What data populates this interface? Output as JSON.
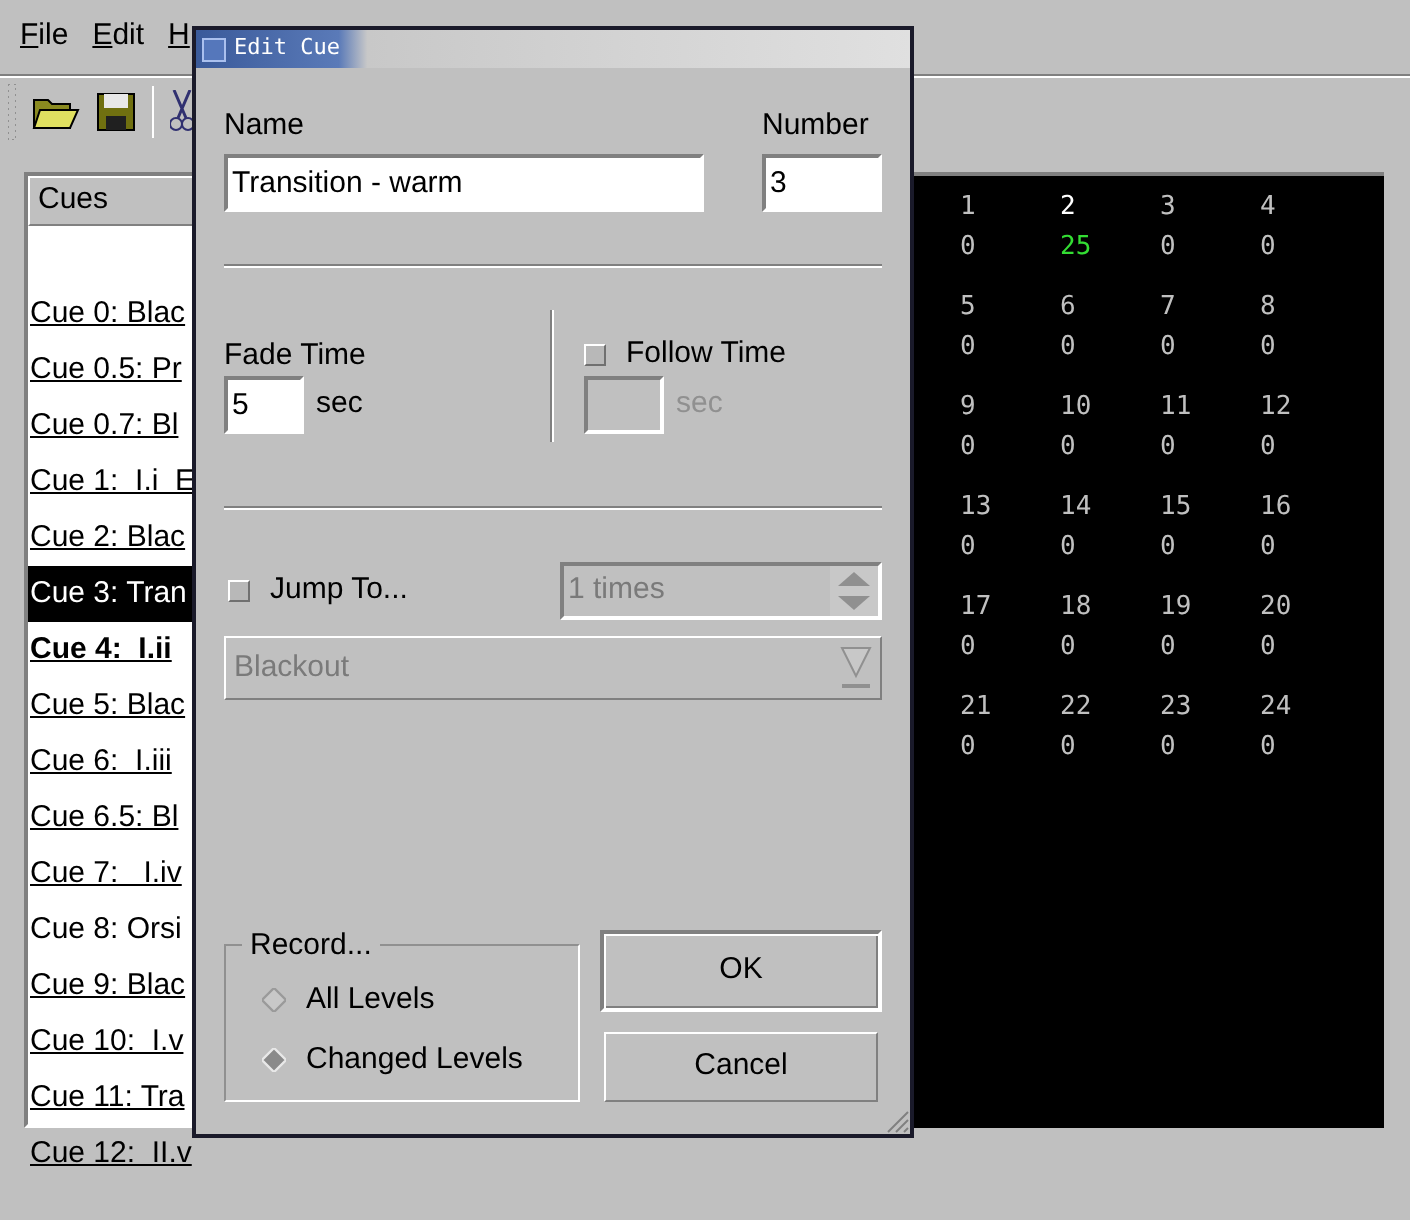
{
  "menu": [
    {
      "label": "File"
    },
    {
      "label": "Edit"
    },
    {
      "label": "H"
    }
  ],
  "cue_list": {
    "header": "Cues",
    "items": [
      {
        "label": "Cue 0: Blac",
        "selected": false,
        "current": false,
        "underlined": true
      },
      {
        "label": "Cue 0.5: Pr",
        "selected": false,
        "current": false,
        "underlined": true
      },
      {
        "label": "Cue 0.7: Bl",
        "selected": false,
        "current": false,
        "underlined": true
      },
      {
        "label": "Cue 1:  I.i  E",
        "selected": false,
        "current": false,
        "underlined": true
      },
      {
        "label": "Cue 2: Blac",
        "selected": false,
        "current": false,
        "underlined": true
      },
      {
        "label": "Cue 3: Tran",
        "selected": true,
        "current": false,
        "underlined": false
      },
      {
        "label": "Cue 4:  I.ii",
        "selected": false,
        "current": true,
        "underlined": true
      },
      {
        "label": "Cue 5: Blac",
        "selected": false,
        "current": false,
        "underlined": true
      },
      {
        "label": "Cue 6:  I.iii",
        "selected": false,
        "current": false,
        "underlined": true
      },
      {
        "label": "Cue 6.5: Bl",
        "selected": false,
        "current": false,
        "underlined": true
      },
      {
        "label": "Cue 7:   I.iv",
        "selected": false,
        "current": false,
        "underlined": true
      },
      {
        "label": "Cue 8: Orsi",
        "selected": false,
        "current": false,
        "underlined": false
      },
      {
        "label": "Cue 9: Blac",
        "selected": false,
        "current": false,
        "underlined": true
      },
      {
        "label": "Cue 10:  I.v",
        "selected": false,
        "current": false,
        "underlined": true
      },
      {
        "label": "Cue 11: Tra",
        "selected": false,
        "current": false,
        "underlined": true
      },
      {
        "label": "Cue 12:  II.v",
        "selected": false,
        "current": false,
        "underlined": true
      }
    ]
  },
  "channels": [
    {
      "number": "1",
      "value": "0",
      "changed": false
    },
    {
      "number": "2",
      "value": "25",
      "changed": true
    },
    {
      "number": "3",
      "value": "0",
      "changed": false
    },
    {
      "number": "4",
      "value": "0",
      "changed": false
    },
    {
      "number": "5",
      "value": "0",
      "changed": false
    },
    {
      "number": "6",
      "value": "0",
      "changed": false
    },
    {
      "number": "7",
      "value": "0",
      "changed": false
    },
    {
      "number": "8",
      "value": "0",
      "changed": false
    },
    {
      "number": "9",
      "value": "0",
      "changed": false
    },
    {
      "number": "10",
      "value": "0",
      "changed": false
    },
    {
      "number": "11",
      "value": "0",
      "changed": false
    },
    {
      "number": "12",
      "value": "0",
      "changed": false
    },
    {
      "number": "13",
      "value": "0",
      "changed": false
    },
    {
      "number": "14",
      "value": "0",
      "changed": false
    },
    {
      "number": "15",
      "value": "0",
      "changed": false
    },
    {
      "number": "16",
      "value": "0",
      "changed": false
    },
    {
      "number": "17",
      "value": "0",
      "changed": false
    },
    {
      "number": "18",
      "value": "0",
      "changed": false
    },
    {
      "number": "19",
      "value": "0",
      "changed": false
    },
    {
      "number": "20",
      "value": "0",
      "changed": false
    },
    {
      "number": "21",
      "value": "0",
      "changed": false
    },
    {
      "number": "22",
      "value": "0",
      "changed": false
    },
    {
      "number": "23",
      "value": "0",
      "changed": false
    },
    {
      "number": "24",
      "value": "0",
      "changed": false
    }
  ],
  "dialog": {
    "title": "Edit Cue",
    "name": {
      "label": "Name",
      "value": "Transition - warm"
    },
    "number": {
      "label": "Number",
      "value": "3"
    },
    "fade": {
      "label": "Fade Time",
      "value": "5",
      "unit": "sec"
    },
    "follow": {
      "label": "Follow Time",
      "checked": false,
      "unit": "sec"
    },
    "jump": {
      "label": "Jump To...",
      "checked": false,
      "times": "1 times",
      "target": "Blackout"
    },
    "record": {
      "legend": "Record...",
      "options": [
        {
          "label": "All Levels",
          "selected": false
        },
        {
          "label": "Changed Levels",
          "selected": true
        }
      ]
    },
    "buttons": [
      {
        "label": "OK",
        "default": true
      },
      {
        "label": "Cancel",
        "default": false
      }
    ]
  }
}
